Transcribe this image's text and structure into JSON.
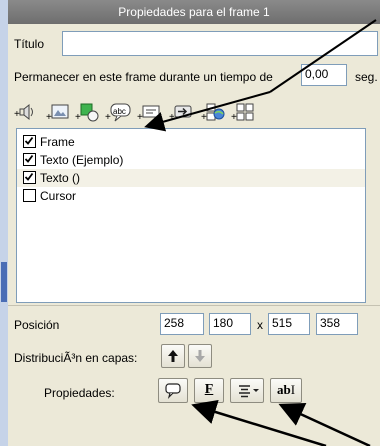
{
  "window": {
    "title": "Propiedades para el frame 1"
  },
  "titulo": {
    "label": "Título",
    "value": ""
  },
  "stay": {
    "label": "Permanecer en este frame durante un tiempo de",
    "value": "0,00",
    "unit": "seg."
  },
  "toolbar": {
    "icons": [
      "sound-icon",
      "image-icon",
      "shape-icon",
      "text-balloon-icon",
      "text-field-icon",
      "button-icon",
      "globe-link-icon",
      "grid-icon"
    ]
  },
  "list": {
    "items": [
      {
        "label": "Frame",
        "checked": true
      },
      {
        "label": "Texto (Ejemplo)",
        "checked": true
      },
      {
        "label": "Texto ()",
        "checked": true
      },
      {
        "label": "Cursor",
        "checked": false
      }
    ]
  },
  "position": {
    "label": "Posición",
    "v1": "258",
    "v2": "180",
    "x": "x",
    "v3": "515",
    "v4": "358"
  },
  "layers": {
    "label": "DistribuciÃ³n en capas:"
  },
  "props": {
    "label": "Propiedades:",
    "font_label": "F",
    "text_label": "ab"
  }
}
